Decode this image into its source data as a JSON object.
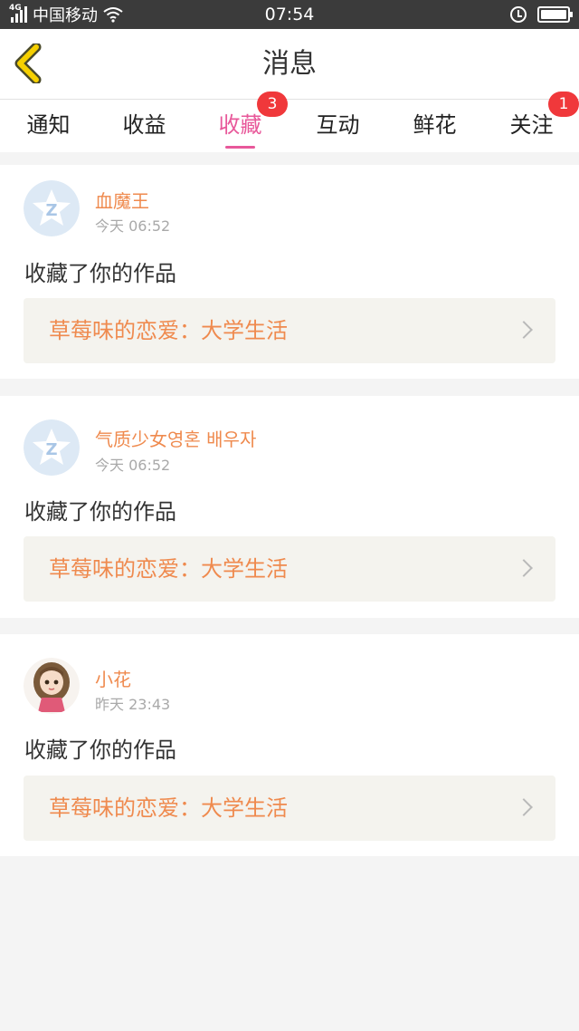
{
  "status_bar": {
    "network": "4G",
    "carrier": "中国移动",
    "time": "07:54"
  },
  "header": {
    "title": "消息",
    "back_icon": "chevron-left-icon",
    "accent_color": "#f6d000"
  },
  "tabs": [
    {
      "label": "通知"
    },
    {
      "label": "收益"
    },
    {
      "label": "收藏",
      "badge": "3",
      "active": true
    },
    {
      "label": "互动"
    },
    {
      "label": "鲜花"
    },
    {
      "label": "关注",
      "badge": "1"
    }
  ],
  "colors": {
    "active_tab": "#e8589a",
    "username": "#ef8a4e",
    "badge": "#f0383b"
  },
  "messages": [
    {
      "username": "血魔王",
      "time": "今天 06:52",
      "action": "收藏了你的作品",
      "work_title": "草莓味的恋爱：大学生活",
      "avatar": "default-avatar-icon"
    },
    {
      "username": "气质少女영혼 배우자",
      "time": "今天 06:52",
      "action": "收藏了你的作品",
      "work_title": "草莓味的恋爱：大学生活",
      "avatar": "default-avatar-icon"
    },
    {
      "username": "小花",
      "time": "昨天 23:43",
      "action": "收藏了你的作品",
      "work_title": "草莓味的恋爱：大学生活",
      "avatar": "girl-avatar-image"
    }
  ]
}
